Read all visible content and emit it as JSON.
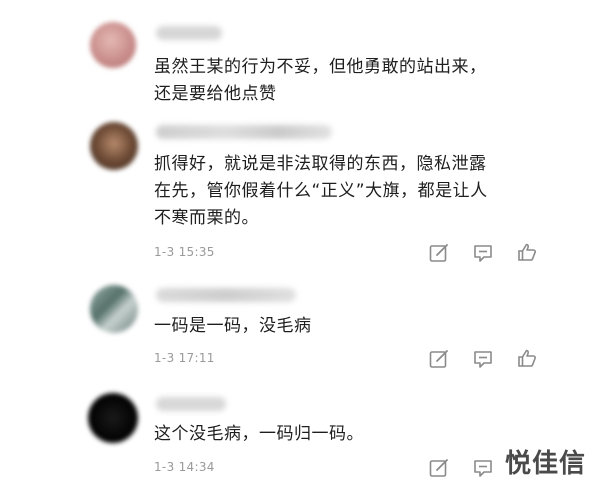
{
  "comments": [
    {
      "text": "虽然王某的行为不妥，但他勇敢的站出来，\n还是要给他点赞",
      "time": ""
    },
    {
      "text": "抓得好，就说是非法取得的东西，隐私泄露\n在先，管你假着什么“正义”大旗，都是让人\n不寒而栗的。",
      "time": "1-3 15:35"
    },
    {
      "text": "一码是一码，没毛病",
      "time": "1-3 17:11"
    },
    {
      "text": "这个没毛病，一码归一码。",
      "time": "1-3 14:34"
    }
  ],
  "icons": {
    "edit": "edit-icon",
    "reply": "message-icon",
    "like": "thumbs-up-icon"
  },
  "watermark": "悦佳信"
}
